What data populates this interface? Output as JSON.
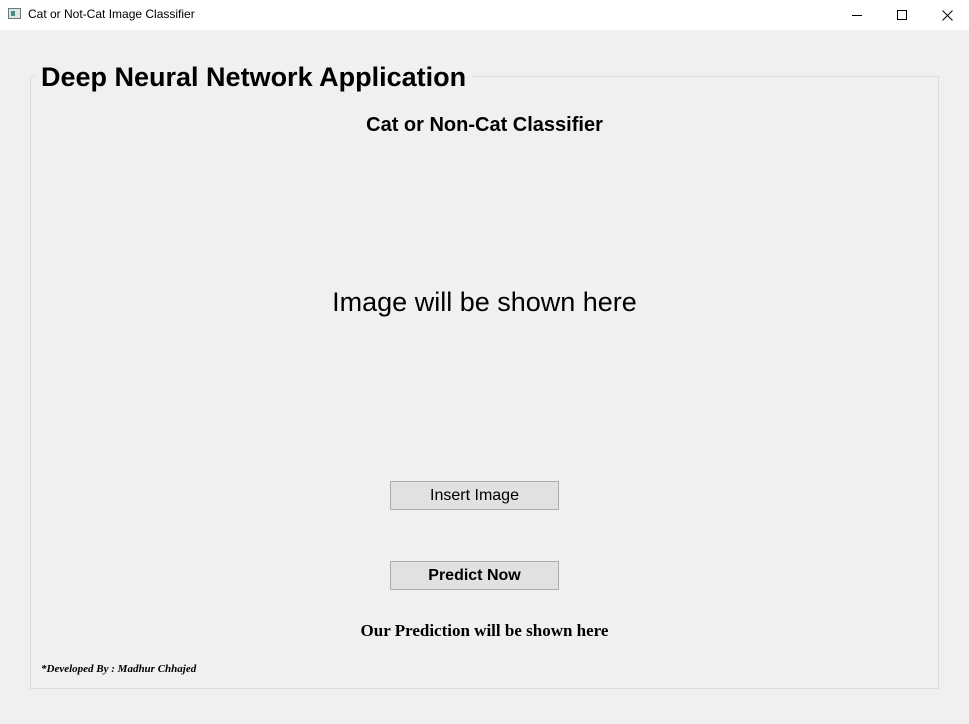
{
  "window": {
    "title": "Cat or Not-Cat Image Classifier",
    "controls": {
      "minimize_icon": "minimize-icon",
      "maximize_icon": "maximize-icon",
      "close_icon": "close-icon"
    }
  },
  "app": {
    "group_title": "Deep Neural Network Application",
    "subtitle": "Cat or Non-Cat Classifier",
    "image_placeholder": "Image will be shown here",
    "insert_button_label": "Insert Image",
    "predict_button_label": "Predict Now",
    "prediction_text": "Our Prediction will be shown here",
    "credits": "*Developed By : Madhur Chhajed"
  }
}
